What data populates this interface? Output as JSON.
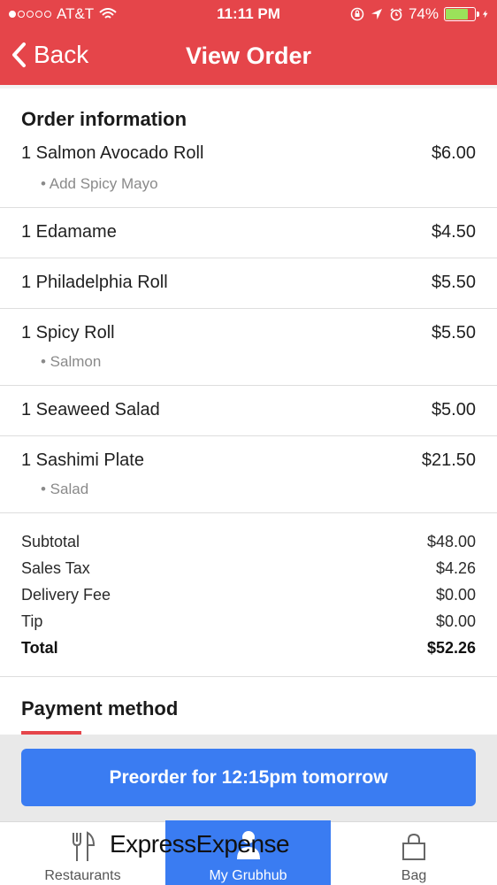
{
  "status_bar": {
    "carrier": "AT&T",
    "time": "11:11 PM",
    "battery_percent": "74%",
    "battery_level": 0.74,
    "signal_dots_filled": 1,
    "signal_dots_total": 5
  },
  "nav": {
    "back_label": "Back",
    "title": "View Order"
  },
  "order": {
    "section_title": "Order information",
    "items": [
      {
        "name": "1 Salmon Avocado Roll",
        "price": "$6.00",
        "modifier": "• Add Spicy Mayo"
      },
      {
        "name": "1 Edamame",
        "price": "$4.50",
        "modifier": ""
      },
      {
        "name": "1 Philadelphia Roll",
        "price": "$5.50",
        "modifier": ""
      },
      {
        "name": "1 Spicy Roll",
        "price": "$5.50",
        "modifier": "• Salmon"
      },
      {
        "name": "1 Seaweed Salad",
        "price": "$5.00",
        "modifier": ""
      },
      {
        "name": "1 Sashimi Plate",
        "price": "$21.50",
        "modifier": "• Salad"
      }
    ]
  },
  "totals": {
    "subtotal_label": "Subtotal",
    "subtotal": "$48.00",
    "tax_label": "Sales Tax",
    "tax": "$4.26",
    "delivery_label": "Delivery Fee",
    "delivery": "$0.00",
    "tip_label": "Tip",
    "tip": "$0.00",
    "total_label": "Total",
    "total": "$52.26"
  },
  "payment": {
    "section_title": "Payment method"
  },
  "actions": {
    "preorder_label": "Preorder for 12:15pm tomorrow"
  },
  "tabs": {
    "restaurants": "Restaurants",
    "my_grubhub": "My Grubhub",
    "bag": "Bag"
  },
  "watermark": "ExpressExpense",
  "colors": {
    "brand_red": "#e5454a",
    "accent_blue": "#3a7cf2"
  },
  "icons": [
    "wifi-icon",
    "lock-rotation-icon",
    "location-arrow-icon",
    "alarm-icon",
    "charging-bolt-icon",
    "chevron-left-icon",
    "fork-knife-icon",
    "person-icon",
    "bag-icon"
  ]
}
